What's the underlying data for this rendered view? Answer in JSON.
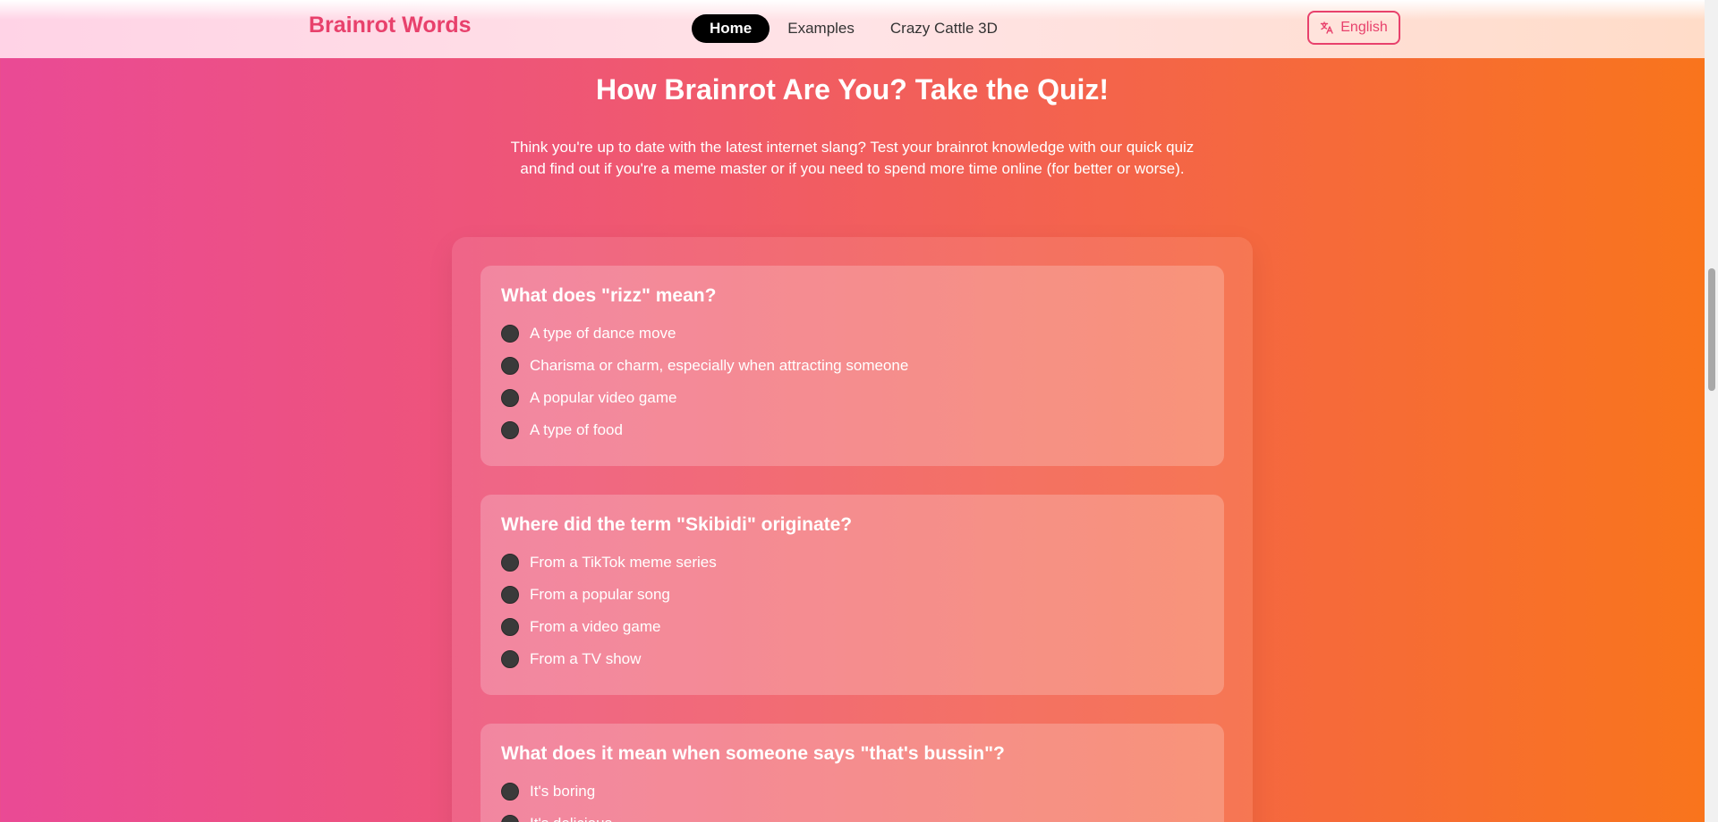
{
  "header": {
    "logo": "Brainrot Words",
    "nav": [
      {
        "label": "Home",
        "active": true
      },
      {
        "label": "Examples",
        "active": false
      },
      {
        "label": "Crazy Cattle 3D",
        "active": false
      }
    ],
    "language": "English",
    "language_icon": "translate-icon"
  },
  "main": {
    "title": "How Brainrot Are You? Take the Quiz!",
    "intro": "Think you're up to date with the latest internet slang? Test your brainrot knowledge with our quick quiz and find out if you're a meme master or if you need to spend more time online (for better or worse).",
    "questions": [
      {
        "question": "What does \"rizz\" mean?",
        "options": [
          "A type of dance move",
          "Charisma or charm, especially when attracting someone",
          "A popular video game",
          "A type of food"
        ]
      },
      {
        "question": "Where did the term \"Skibidi\" originate?",
        "options": [
          "From a TikTok meme series",
          "From a popular song",
          "From a video game",
          "From a TV show"
        ]
      },
      {
        "question": "What does it mean when someone says \"that's bussin\"?",
        "options": [
          "It's boring",
          "It's delicious"
        ]
      }
    ]
  },
  "colors": {
    "brand": "#e8416c",
    "gradient_start": "#ea4a95",
    "gradient_end": "#f9751b"
  }
}
